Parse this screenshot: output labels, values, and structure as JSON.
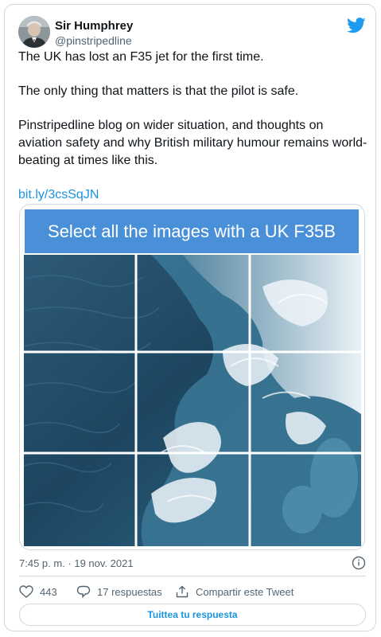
{
  "author": {
    "name": "Sir Humphrey",
    "handle": "@pinstripedline"
  },
  "tweet": {
    "line1": "The UK has lost an F35 jet for the first time.",
    "line2": "The only thing that matters is that the pilot is safe.",
    "line3": "Pinstripedline blog on wider situation, and thoughts on aviation safety and why British military humour remains world-beating at times like this.",
    "link": "bit.ly/3csSqJN"
  },
  "captcha": {
    "prompt": "Select all the images with a UK F35B",
    "grid_rows": 3,
    "grid_cols": 3
  },
  "meta": {
    "timestamp": "7:45 p. m. · 19 nov. 2021"
  },
  "actions": {
    "likes": "443",
    "replies": "17 respuestas",
    "share": "Compartir este Tweet"
  },
  "reply_button": {
    "label": "Tuittea tu respuesta"
  },
  "icons": {
    "brand": "twitter-bird-icon",
    "info": "info-icon",
    "like": "heart-icon",
    "reply": "reply-bubble-icon",
    "share": "share-icon"
  },
  "colors": {
    "accent": "#1b95e0",
    "captcha_header": "#4a90d9",
    "secondary_text": "#536471"
  }
}
